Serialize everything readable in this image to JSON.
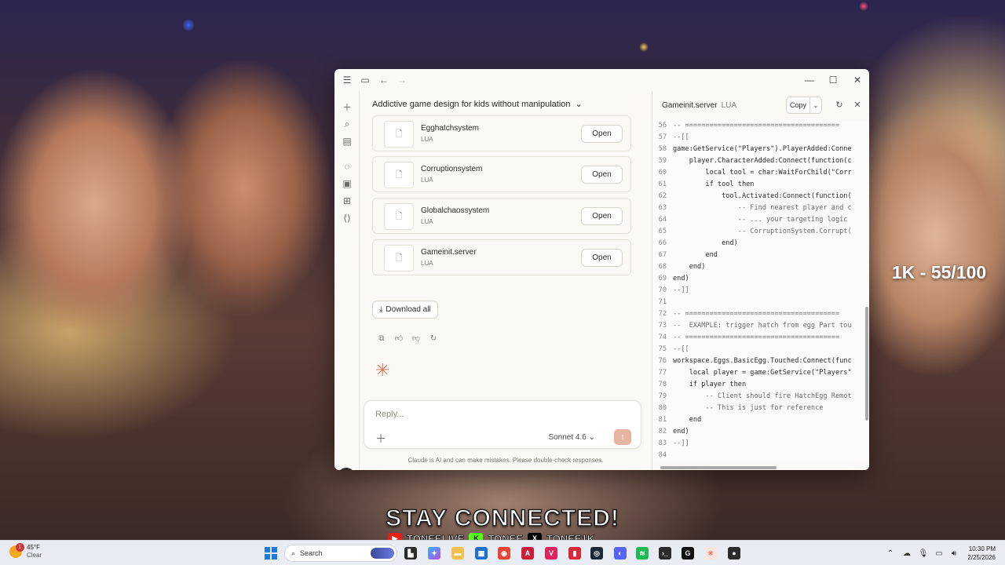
{
  "overlay": {
    "stat": "1K - 55/100",
    "banner_title": "STAY CONNECTED!",
    "socials": [
      "TONEELIVE",
      "TONEE",
      "TONEE1K"
    ]
  },
  "app": {
    "conversation_title": "Addictive game design for kids without manipulation",
    "files": [
      {
        "name": "Egghatchsystem",
        "type": "LUA",
        "action": "Open"
      },
      {
        "name": "Corruptionsystem",
        "type": "LUA",
        "action": "Open"
      },
      {
        "name": "Globalchaossystem",
        "type": "LUA",
        "action": "Open"
      },
      {
        "name": "Gameinit.server",
        "type": "LUA",
        "action": "Open"
      }
    ],
    "download_all": "Download all",
    "composer": {
      "placeholder": "Reply...",
      "model": "Sonnet 4.6"
    },
    "disclaimer": "Claude is AI and can make mistakes. Please double-check responses.",
    "avatar_initial": "1",
    "artifact": {
      "title": "Gameinit.server",
      "lang": "LUA",
      "copy_label": "Copy",
      "lines": [
        {
          "n": "56",
          "code": "-- ======================================",
          "comment": true
        },
        {
          "n": "57",
          "code": "--[[",
          "comment": true
        },
        {
          "n": "58",
          "code": "game:GetService(\"Players\").PlayerAdded:Conne",
          "comment": false
        },
        {
          "n": "59",
          "code": "    player.CharacterAdded:Connect(function(c",
          "comment": false
        },
        {
          "n": "60",
          "code": "        local tool = char:WaitForChild(\"Corr",
          "comment": false
        },
        {
          "n": "61",
          "code": "        if tool then",
          "comment": false
        },
        {
          "n": "62",
          "code": "            tool.Activated:Connect(function(",
          "comment": false
        },
        {
          "n": "63",
          "code": "                -- Find nearest player and c",
          "comment": true
        },
        {
          "n": "64",
          "code": "                -- ... your targeting logic",
          "comment": true
        },
        {
          "n": "65",
          "code": "                -- CorruptionSystem.Corrupt(",
          "comment": true
        },
        {
          "n": "66",
          "code": "            end)",
          "comment": false
        },
        {
          "n": "67",
          "code": "        end",
          "comment": false
        },
        {
          "n": "68",
          "code": "    end)",
          "comment": false
        },
        {
          "n": "69",
          "code": "end)",
          "comment": false
        },
        {
          "n": "70",
          "code": "--]]",
          "comment": true
        },
        {
          "n": "71",
          "code": "",
          "comment": false
        },
        {
          "n": "72",
          "code": "-- ======================================",
          "comment": true
        },
        {
          "n": "73",
          "code": "--  EXAMPLE: trigger hatch from egg Part tou",
          "comment": true
        },
        {
          "n": "74",
          "code": "-- ======================================",
          "comment": true
        },
        {
          "n": "75",
          "code": "--[[",
          "comment": true
        },
        {
          "n": "76",
          "code": "workspace.Eggs.BasicEgg.Touched:Connect(func",
          "comment": false
        },
        {
          "n": "77",
          "code": "    local player = game:GetService(\"Players\"",
          "comment": false
        },
        {
          "n": "78",
          "code": "    if player then",
          "comment": false
        },
        {
          "n": "79",
          "code": "        -- Client should fire HatchEgg Remot",
          "comment": true
        },
        {
          "n": "80",
          "code": "        -- This is just for reference",
          "comment": true
        },
        {
          "n": "81",
          "code": "    end",
          "comment": false
        },
        {
          "n": "82",
          "code": "end)",
          "comment": false
        },
        {
          "n": "83",
          "code": "--]]",
          "comment": true
        },
        {
          "n": "84",
          "code": "",
          "comment": false
        }
      ]
    }
  },
  "taskbar": {
    "weather_temp": "45°F",
    "weather_cond": "Clear",
    "weather_badge": "1",
    "search_label": "Search",
    "time": "10:30 PM",
    "date": "2/25/2026"
  }
}
